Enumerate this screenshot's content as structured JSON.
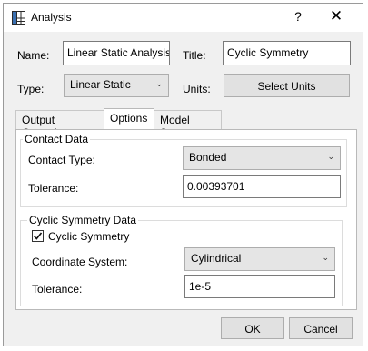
{
  "window": {
    "title": "Analysis",
    "help_symbol": "?",
    "close_symbol": "✕",
    "icon": "app-grid-icon"
  },
  "form": {
    "name_label": "Name:",
    "name_value": "Linear Static Analysis",
    "title_label": "Title:",
    "title_value": "Cyclic Symmetry",
    "type_label": "Type:",
    "type_value": "Linear Static",
    "units_label": "Units:",
    "units_button": "Select Units"
  },
  "tabs": [
    {
      "label": "Output Controls"
    },
    {
      "label": "Options"
    },
    {
      "label": "Model State"
    }
  ],
  "contact": {
    "group_title": "Contact Data",
    "type_label": "Contact Type:",
    "type_value": "Bonded",
    "tolerance_label": "Tolerance:",
    "tolerance_value": "0.00393701"
  },
  "cyclic": {
    "group_title": "Cyclic Symmetry Data",
    "checkbox_label": "Cyclic Symmetry",
    "checkbox_checked": true,
    "coord_label": "Coordinate System:",
    "coord_value": "Cylindrical",
    "tolerance_label": "Tolerance:",
    "tolerance_value": "1e-5"
  },
  "buttons": {
    "ok": "OK",
    "cancel": "Cancel"
  },
  "colors": {
    "dialog_bg": "#f0f0f0",
    "button_bg": "#e1e1e1",
    "border": "#adadad"
  }
}
